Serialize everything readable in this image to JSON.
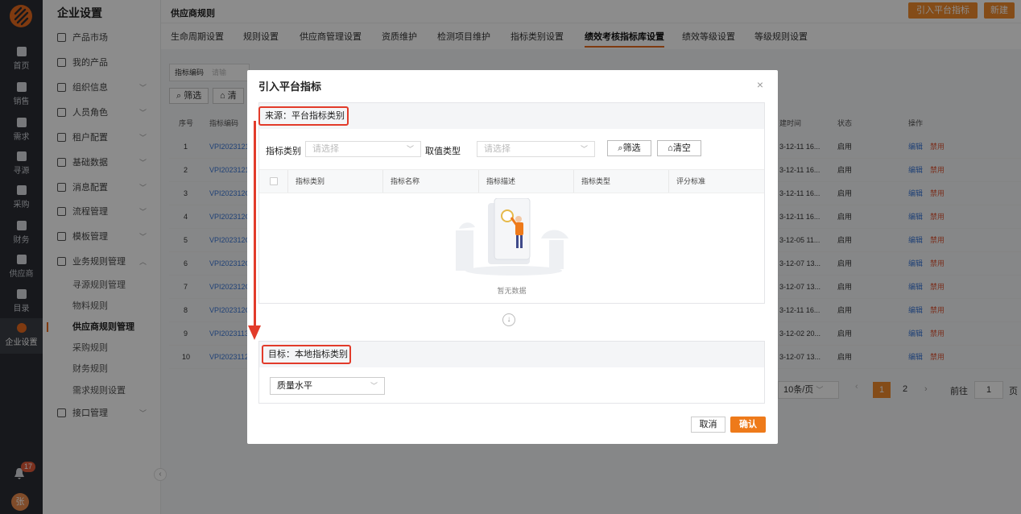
{
  "rail": {
    "items": [
      {
        "label": "首页",
        "icon": "monitor-icon"
      },
      {
        "label": "销售",
        "icon": "person-icon"
      },
      {
        "label": "需求",
        "icon": "clipboard-icon"
      },
      {
        "label": "寻源",
        "icon": "search-icon"
      },
      {
        "label": "采购",
        "icon": "cart-icon"
      },
      {
        "label": "财务",
        "icon": "wallet-icon"
      },
      {
        "label": "供应商",
        "icon": "person-icon"
      },
      {
        "label": "目录",
        "icon": "catalog-icon"
      },
      {
        "label": "企业设置",
        "icon": "gear-icon"
      }
    ],
    "notification_count": "17",
    "avatar_text": "张"
  },
  "sidebar": {
    "title": "企业设置",
    "items": [
      {
        "label": "产品市场"
      },
      {
        "label": "我的产品"
      },
      {
        "label": "组织信息"
      },
      {
        "label": "人员角色"
      },
      {
        "label": "租户配置"
      },
      {
        "label": "基础数据"
      },
      {
        "label": "消息配置"
      },
      {
        "label": "流程管理"
      },
      {
        "label": "模板管理"
      },
      {
        "label": "业务规则管理"
      }
    ],
    "sub_items": [
      {
        "label": "寻源规则管理"
      },
      {
        "label": "物料规则"
      },
      {
        "label": "供应商规则管理"
      },
      {
        "label": "采购规则"
      },
      {
        "label": "财务规则"
      },
      {
        "label": "需求规则设置"
      }
    ],
    "last_item": "接口管理"
  },
  "header": {
    "title": "供应商规则",
    "import_button": "引入平台指标",
    "new_button": "新建"
  },
  "tabs": [
    {
      "label": "生命周期设置"
    },
    {
      "label": "规则设置"
    },
    {
      "label": "供应商管理设置"
    },
    {
      "label": "资质维护"
    },
    {
      "label": "检测项目维护"
    },
    {
      "label": "指标类别设置"
    },
    {
      "label": "绩效考核指标库设置"
    },
    {
      "label": "绩效等级设置"
    },
    {
      "label": "等级规则设置"
    }
  ],
  "filters": {
    "code_label": "指标编码",
    "code_placeholder": "请输",
    "filter_button": "筛选",
    "clear_button": "清"
  },
  "table": {
    "headers": {
      "index": "序号",
      "code": "指标编码",
      "time": "建时间",
      "status": "状态",
      "action": "操作"
    },
    "rows": [
      {
        "index": "1",
        "code": "VPI2023121",
        "time": "3-12-11 16...",
        "status": "启用"
      },
      {
        "index": "2",
        "code": "VPI2023121",
        "time": "3-12-11 16...",
        "status": "启用"
      },
      {
        "index": "3",
        "code": "VPI202312C",
        "time": "3-12-11 16...",
        "status": "启用"
      },
      {
        "index": "4",
        "code": "VPI202312C",
        "time": "3-12-11 16...",
        "status": "启用"
      },
      {
        "index": "5",
        "code": "VPI202312C",
        "time": "3-12-05 11...",
        "status": "启用"
      },
      {
        "index": "6",
        "code": "VPI202312C",
        "time": "3-12-07 13...",
        "status": "启用"
      },
      {
        "index": "7",
        "code": "VPI202312C",
        "time": "3-12-07 13...",
        "status": "启用"
      },
      {
        "index": "8",
        "code": "VPI202312C",
        "time": "3-12-11 16...",
        "status": "启用"
      },
      {
        "index": "9",
        "code": "VPI2023113",
        "time": "3-12-02 20...",
        "status": "启用"
      },
      {
        "index": "10",
        "code": "VPI2023112",
        "time": "3-12-07 13...",
        "status": "启用"
      }
    ],
    "edit_label": "编辑",
    "disable_label": "禁用"
  },
  "pagination": {
    "page_size": "10条/页",
    "current_page": "1",
    "next_page": "2",
    "goto_label": "前往",
    "goto_value": "1",
    "page_unit": "页"
  },
  "modal": {
    "title": "引入平台指标",
    "source_label": "来源：平台指标类别",
    "category_label": "指标类别",
    "category_placeholder": "请选择",
    "value_type_label": "取值类型",
    "value_type_placeholder": "请选择",
    "filter_button": "筛选",
    "clear_button": "清空",
    "columns": [
      "指标类别",
      "指标名称",
      "指标描述",
      "指标类型",
      "评分标准"
    ],
    "empty_text": "暂无数据",
    "target_label": "目标：本地指标类别",
    "target_value": "质量水平",
    "cancel_button": "取消",
    "confirm_button": "确认"
  }
}
